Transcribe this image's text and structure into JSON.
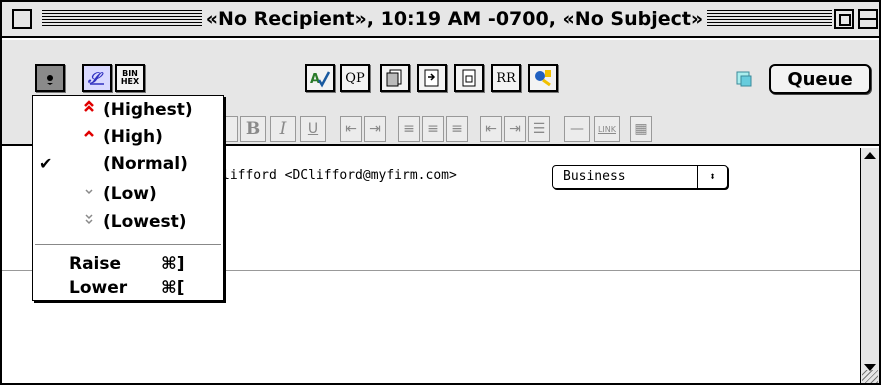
{
  "window": {
    "title": "«No Recipient», 10:19 AM -0700, «No Subject»"
  },
  "toolbar": {
    "binhex_label": "BIN\nHEX",
    "qp_label": "QP",
    "rr_label": "RR",
    "queue_label": "Queue"
  },
  "format_bar": {
    "bold": "B",
    "italic": "I",
    "underline": "U",
    "link": "LINK"
  },
  "header": {
    "from_text": "lifford <DClifford@myfirm.com>",
    "persona_value": "Business"
  },
  "priority_menu": {
    "items": [
      {
        "label": "(Highest)",
        "icon": "double-caret-up-icon",
        "color": "#e00000",
        "checked": false
      },
      {
        "label": "(High)",
        "icon": "caret-up-icon",
        "color": "#e00000",
        "checked": false
      },
      {
        "label": "(Normal)",
        "icon": "",
        "color": "",
        "checked": true
      },
      {
        "label": "(Low)",
        "icon": "caret-down-icon",
        "color": "#8a8a8a",
        "checked": false
      },
      {
        "label": "(Lowest)",
        "icon": "double-caret-down-icon",
        "color": "#8a8a8a",
        "checked": false
      }
    ],
    "commands": [
      {
        "label": "Raise",
        "shortcut": "⌘]"
      },
      {
        "label": "Lower",
        "shortcut": "⌘["
      }
    ]
  }
}
